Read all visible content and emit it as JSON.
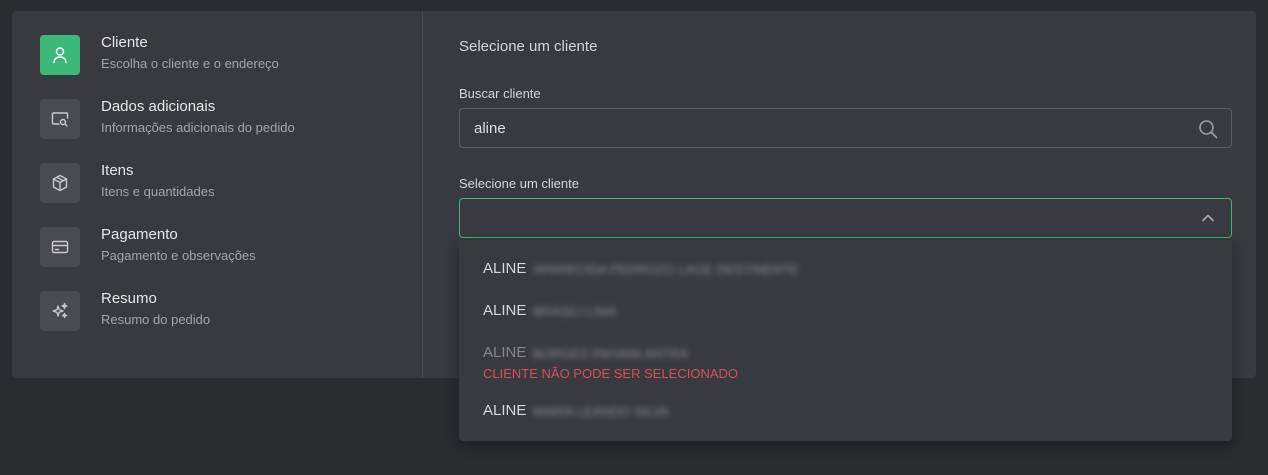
{
  "steps": [
    {
      "title": "Cliente",
      "subtitle": "Escolha o cliente e o endereço",
      "icon": "user-icon",
      "active": true
    },
    {
      "title": "Dados adicionais",
      "subtitle": "Informações adicionais do pedido",
      "icon": "search-window-icon",
      "active": false
    },
    {
      "title": "Itens",
      "subtitle": "Itens e quantidades",
      "icon": "box-icon",
      "active": false
    },
    {
      "title": "Pagamento",
      "subtitle": "Pagamento e observações",
      "icon": "credit-card-icon",
      "active": false
    },
    {
      "title": "Resumo",
      "subtitle": "Resumo do pedido",
      "icon": "sparkles-icon",
      "active": false
    }
  ],
  "main": {
    "section_title": "Selecione um cliente",
    "search_label": "Buscar cliente",
    "search_value": "aline",
    "select_label": "Selecione um cliente",
    "select_value": ""
  },
  "dropdown": {
    "options": [
      {
        "first": "ALINE",
        "rest": "APARECIDA PEDROZO LAGE DESTINENTE",
        "disabled": false,
        "error": ""
      },
      {
        "first": "ALINE",
        "rest": "BRASILI LIMA",
        "disabled": false,
        "error": ""
      },
      {
        "first": "ALINE",
        "rest": "BORGES PAIVANI ANTRA",
        "disabled": true,
        "error": "CLIENTE NÃO PODE SER SELECIONADO"
      },
      {
        "first": "ALINE",
        "rest": "MARIA LEANDO SILVA",
        "disabled": false,
        "error": ""
      }
    ]
  },
  "colors": {
    "accent": "#3cb878",
    "error": "#d2505c",
    "background": "#2b2c30",
    "card": "#393a3f"
  }
}
